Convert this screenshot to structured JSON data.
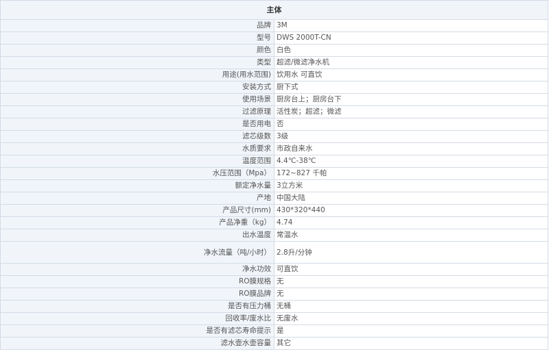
{
  "section_title": "主体",
  "specs": [
    {
      "label": "品牌",
      "value": "3M"
    },
    {
      "label": "型号",
      "value": "DWS 2000T-CN"
    },
    {
      "label": "颜色",
      "value": "白色"
    },
    {
      "label": "类型",
      "value": "超滤/微滤净水机"
    },
    {
      "label": "用途(用水范围)",
      "value": "饮用水 可直饮"
    },
    {
      "label": "安装方式",
      "value": "厨下式"
    },
    {
      "label": "使用场景",
      "value": "厨房台上；厨房台下"
    },
    {
      "label": "过滤原理",
      "value": "活性炭；超滤；微滤"
    },
    {
      "label": "是否用电",
      "value": "否"
    },
    {
      "label": "滤芯级数",
      "value": "3级"
    },
    {
      "label": "水质要求",
      "value": "市政自来水"
    },
    {
      "label": "温度范围",
      "value": "4.4℃-38℃"
    },
    {
      "label": "水压范围（Mpa）",
      "value": "172~827 千帕"
    },
    {
      "label": "额定净水量",
      "value": "3立方米"
    },
    {
      "label": "产地",
      "value": "中国大陆"
    },
    {
      "label": "产品尺寸(mm)",
      "value": "430*320*440"
    },
    {
      "label": "产品净重（kg）",
      "value": "4.74"
    },
    {
      "label": "出水温度",
      "value": "常温水"
    },
    {
      "label": "净水流量（吨/小时）",
      "value": "2.8升/分钟"
    },
    {
      "label": "净水功效",
      "value": "可直饮"
    },
    {
      "label": "RO膜规格",
      "value": "无"
    },
    {
      "label": "RO膜品牌",
      "value": "无"
    },
    {
      "label": "是否有压力桶",
      "value": "无桶"
    },
    {
      "label": "回收率/废水比",
      "value": "无废水"
    },
    {
      "label": "是否有滤芯寿命提示",
      "value": "是"
    },
    {
      "label": "滤水壶水壶容量",
      "value": "其它"
    }
  ]
}
